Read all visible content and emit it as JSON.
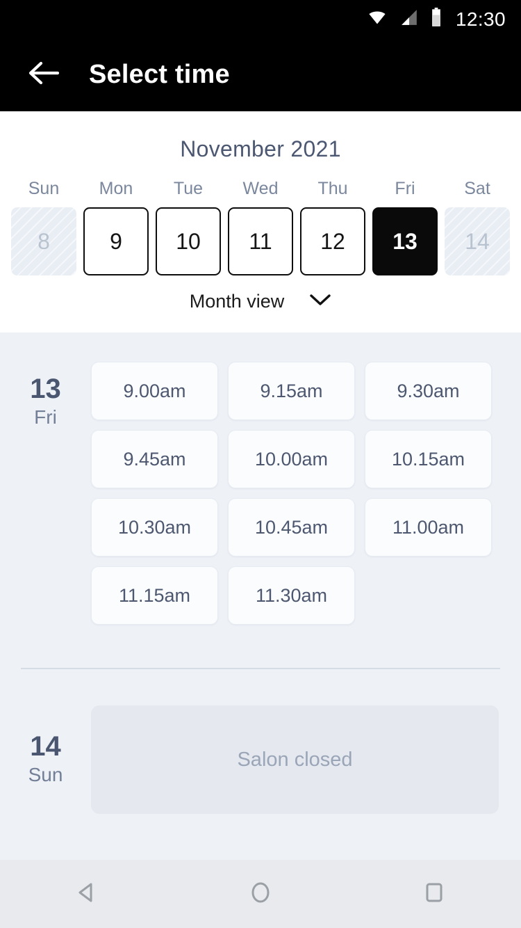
{
  "status_bar": {
    "time": "12:30",
    "icons": [
      "wifi-icon",
      "signal-icon",
      "battery-icon"
    ]
  },
  "app_bar": {
    "back_icon": "back-arrow-icon",
    "title": "Select time"
  },
  "calendar": {
    "month_title": "November 2021",
    "day_headers": [
      "Sun",
      "Mon",
      "Tue",
      "Wed",
      "Thu",
      "Fri",
      "Sat"
    ],
    "dates": [
      {
        "label": "8",
        "state": "disabled"
      },
      {
        "label": "9",
        "state": "enabled"
      },
      {
        "label": "10",
        "state": "enabled"
      },
      {
        "label": "11",
        "state": "enabled"
      },
      {
        "label": "12",
        "state": "enabled"
      },
      {
        "label": "13",
        "state": "selected"
      },
      {
        "label": "14",
        "state": "disabled"
      }
    ],
    "view_selector": {
      "label": "Month view",
      "icon": "chevron-down-icon"
    }
  },
  "schedule": {
    "days": [
      {
        "day_number": "13",
        "day_name": "Fri",
        "slots": [
          "9.00am",
          "9.15am",
          "9.30am",
          "9.45am",
          "10.00am",
          "10.15am",
          "10.30am",
          "10.45am",
          "11.00am",
          "11.15am",
          "11.30am"
        ]
      },
      {
        "day_number": "14",
        "day_name": "Sun",
        "closed_message": "Salon closed"
      }
    ]
  },
  "nav_bar": {
    "back": "nav-back-icon",
    "home": "nav-home-icon",
    "recents": "nav-recents-icon"
  },
  "colors": {
    "app_bar_bg": "#000000",
    "page_bg": "#eef1f6",
    "selected_day_bg": "#0a0a0a",
    "text_primary": "#4a5670",
    "text_muted": "#7a879d",
    "slot_bg": "#fbfcfe",
    "closed_bg": "#e5e9ef"
  }
}
